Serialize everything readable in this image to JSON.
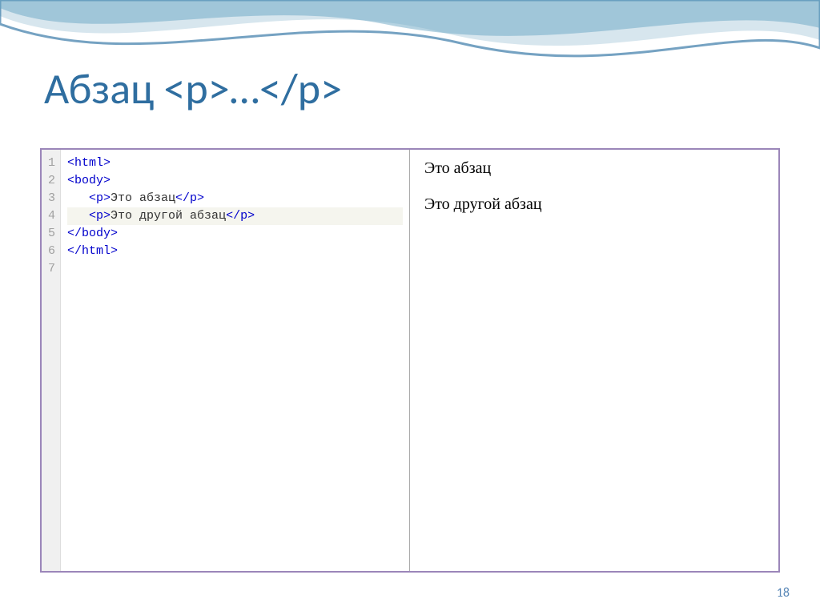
{
  "title": "Абзац  <p>…</p>",
  "code": {
    "line_numbers": [
      "1",
      "2",
      "3",
      "4",
      "5",
      "6",
      "7"
    ],
    "lines": [
      {
        "indent": "",
        "open": "<html>",
        "text": "",
        "close": ""
      },
      {
        "indent": "",
        "open": "<body>",
        "text": "",
        "close": ""
      },
      {
        "indent": "   ",
        "open": "<p>",
        "text": "Это абзац",
        "close": "</p>"
      },
      {
        "indent": "   ",
        "open": "<p>",
        "text": "Это другой абзац",
        "close": "</p>"
      },
      {
        "indent": "",
        "open": "</body>",
        "text": "",
        "close": ""
      },
      {
        "indent": "",
        "open": "</html>",
        "text": "",
        "close": ""
      },
      {
        "indent": "",
        "open": "",
        "text": "",
        "close": ""
      }
    ],
    "current_line_index": 3
  },
  "preview": {
    "p1": "Это абзац",
    "p2": "Это другой абзац"
  },
  "page_number": "18"
}
